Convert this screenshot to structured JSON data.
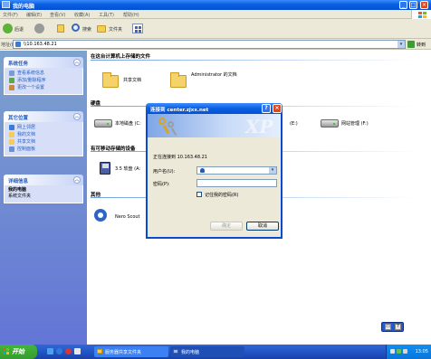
{
  "window": {
    "title": "我的电脑"
  },
  "menu": [
    "文件(F)",
    "编辑(E)",
    "查看(V)",
    "收藏(A)",
    "工具(T)",
    "帮助(H)"
  ],
  "toolbar": {
    "back_label": "后退",
    "search_label": "搜索",
    "folders_label": "文件夹"
  },
  "address": {
    "label": "地址(D)",
    "value": "\\\\10.163.48.21",
    "go_label": "转到"
  },
  "taskpane": {
    "system_tasks": {
      "title": "系统任务",
      "items": [
        "查看系统信息",
        "添加/删除程序",
        "更改一个设置"
      ]
    },
    "other_places": {
      "title": "其它位置",
      "items": [
        "网上邻居",
        "我的文档",
        "共享文档",
        "控制面板"
      ]
    },
    "details": {
      "title": "详细信息",
      "name": "我的电脑",
      "type": "系统文件夹"
    }
  },
  "main": {
    "files_section": "在这台计算机上存储的文件",
    "shared_docs": "共享文档",
    "admin_docs": "Administrator 的文档",
    "drives_section": "硬盘",
    "local_disk": "本地磁盘 (C:",
    "drive_e": "(E:)",
    "network_drive": "网站管理 (F:)",
    "removable_section": "有可移动存储的设备",
    "floppy": "3.5 软盘 (A:",
    "other_section": "其他",
    "nero": "Nero Scout"
  },
  "dialog": {
    "title": "连接到 center.zjxx.net",
    "connecting": "正在连接到 10.163.48.21",
    "username_label": "用户名(U):",
    "password_label": "密码(P):",
    "remember_label": "记住我的密码(R)",
    "ok_label": "确定",
    "cancel_label": "取消",
    "banner_text": "XP"
  },
  "taskbar": {
    "start_label": "开始",
    "tasks": [
      "服务器共享文件夹",
      "我的电脑"
    ],
    "clock": "13:05"
  }
}
